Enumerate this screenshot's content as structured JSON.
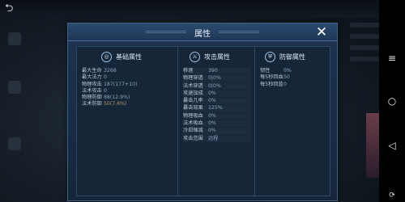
{
  "panel": {
    "title": "属性",
    "close": "✕"
  },
  "columns": [
    {
      "title": "基础属性",
      "icon": "target-icon",
      "rows": [
        {
          "k": "最大生命",
          "v": "3268"
        },
        {
          "k": "最大法力",
          "v": "0"
        },
        {
          "k": "物理攻击",
          "v": "187(177+10)"
        },
        {
          "k": "法术攻击",
          "v": "0"
        },
        {
          "k": "物理防御",
          "v": "88(12.9%)"
        },
        {
          "k": "法术防御",
          "v": "50(7.6%)"
        }
      ]
    },
    {
      "title": "攻击属性",
      "icon": "sword-icon",
      "rows": [
        {
          "k": "移速",
          "v": "390"
        },
        {
          "k": "物理穿透",
          "v": "0|0%"
        },
        {
          "k": "法术穿透",
          "v": "0|0%"
        },
        {
          "k": "攻速加成",
          "v": "0%"
        },
        {
          "k": "暴击几率",
          "v": "0%"
        },
        {
          "k": "暴击效果",
          "v": "125%"
        },
        {
          "k": "物理吸血",
          "v": "0%"
        },
        {
          "k": "法术吸血",
          "v": "0%"
        },
        {
          "k": "冷却缩减",
          "v": "0%"
        },
        {
          "k": "攻击范围",
          "v": "远程"
        }
      ]
    },
    {
      "title": "防御属性",
      "icon": "shield-icon",
      "rows": [
        {
          "k": "韧性",
          "v": "0%"
        },
        {
          "k": "每5秒回血",
          "v": "50"
        },
        {
          "k": "每5秒回蓝",
          "v": "0"
        }
      ]
    }
  ],
  "nav": {
    "menu": "≡",
    "home": "○",
    "back": "◁",
    "rotate": "⟳"
  },
  "colors": {
    "panel_bg": "#1d3450",
    "accent_border": "#3e5f84",
    "value_text": "#8ea3b9"
  }
}
